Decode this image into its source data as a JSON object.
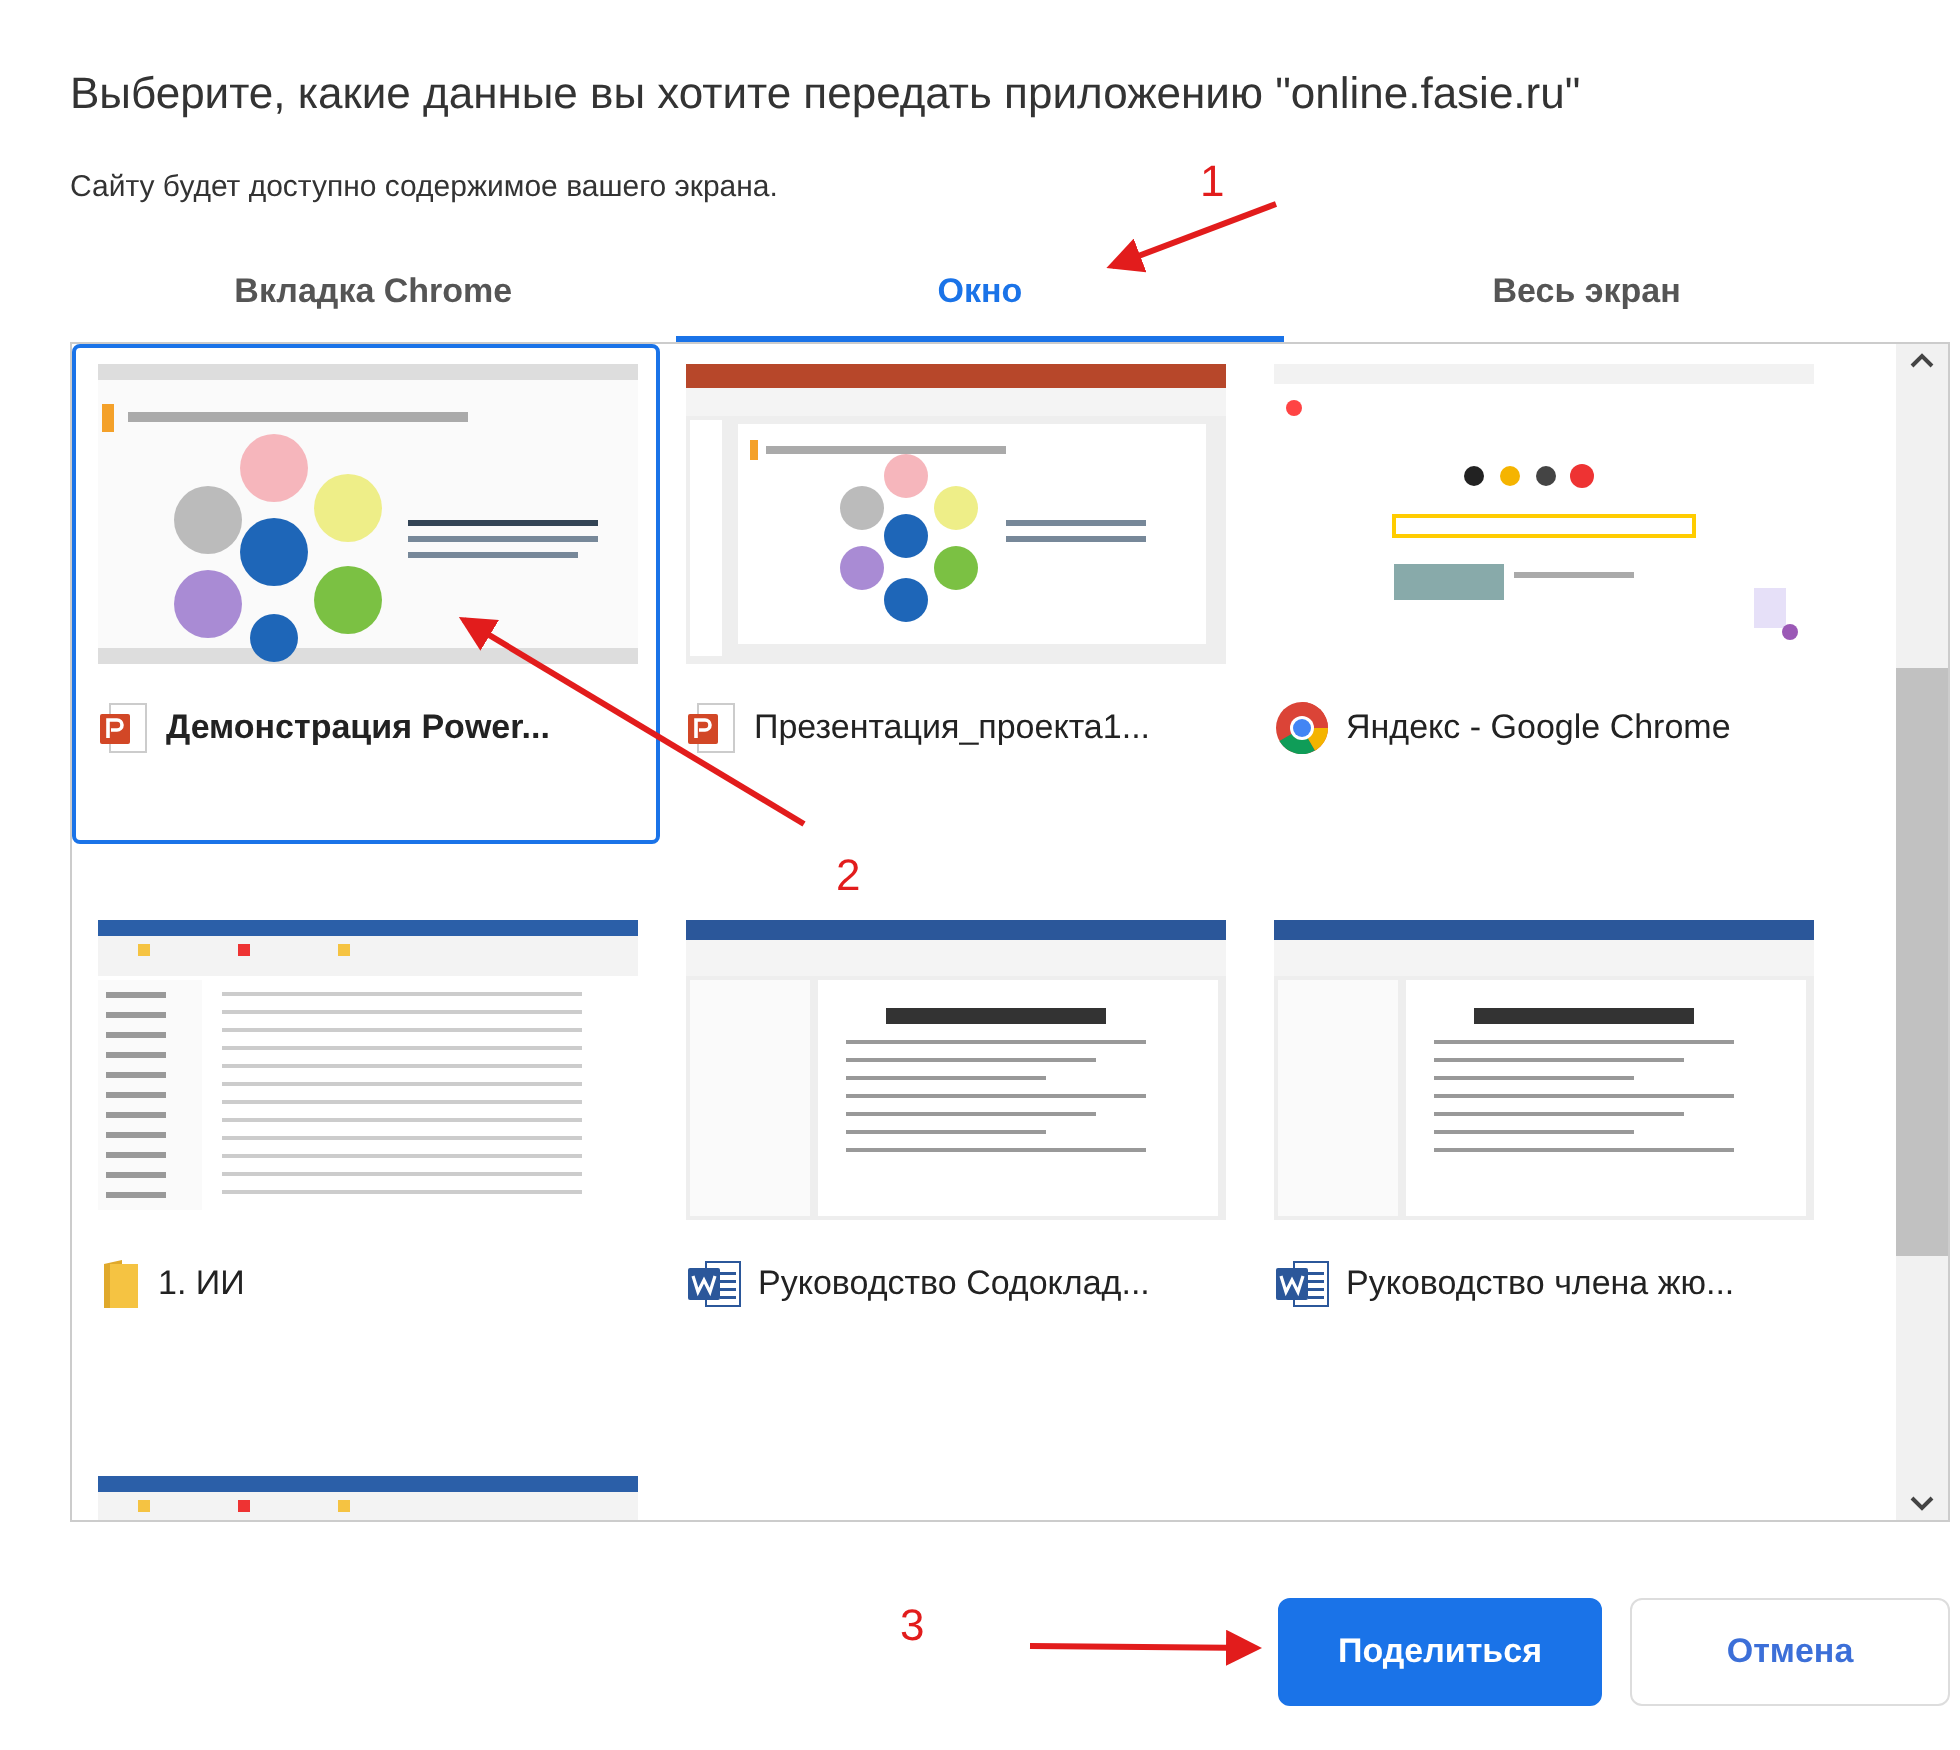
{
  "dialog": {
    "title": "Выберите, какие данные вы хотите передать приложению \"online.fasie.ru\"",
    "subtitle": "Сайту будет доступно содержимое вашего экрана."
  },
  "tabs": [
    {
      "label": "Вкладка Chrome",
      "selected": false
    },
    {
      "label": "Окно",
      "selected": true
    },
    {
      "label": "Весь экран",
      "selected": false
    }
  ],
  "windows": [
    {
      "kind": "slideshow",
      "title": "Демонстрация Power...",
      "selected": true
    },
    {
      "kind": "powerpoint",
      "title": "Презентация_проекта1...",
      "selected": false
    },
    {
      "kind": "browser",
      "title": "Яндекс - Google Chrome",
      "selected": false
    },
    {
      "kind": "explorer",
      "title": "1. ИИ",
      "selected": false
    },
    {
      "kind": "word",
      "title": "Руководство Содоклад...",
      "selected": false
    },
    {
      "kind": "word",
      "title": "Руководство члена жю...",
      "selected": false
    },
    {
      "kind": "explorer",
      "selected": false
    }
  ],
  "buttons": [
    {
      "label": "Поделиться",
      "kind": "primary"
    },
    {
      "label": "Отмена",
      "kind": "secondary"
    }
  ],
  "annotations": [
    {
      "number": "1"
    },
    {
      "number": "2"
    },
    {
      "number": "3"
    }
  ]
}
